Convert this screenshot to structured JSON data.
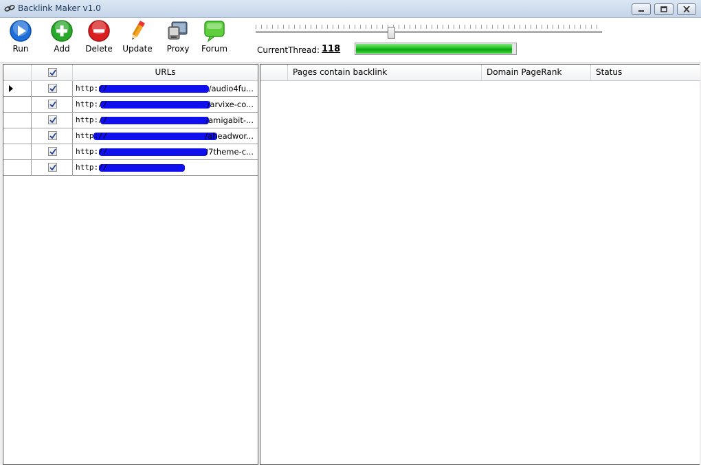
{
  "window": {
    "title": "Backlink Maker v1.0"
  },
  "toolbar": {
    "buttons": [
      {
        "label": "Run",
        "icon": "play-icon"
      },
      {
        "label": "Add",
        "icon": "plus-icon"
      },
      {
        "label": "Delete",
        "icon": "minus-icon"
      },
      {
        "label": "Update",
        "icon": "pencil-icon"
      },
      {
        "label": "Proxy",
        "icon": "proxy-icon"
      },
      {
        "label": "Forum",
        "icon": "chat-bubble-icon"
      }
    ],
    "current_thread_label": "CurrentThread:",
    "current_thread_value": "118",
    "progress_fraction": 0.98,
    "thread_slider_fraction": 0.39
  },
  "url_grid": {
    "header": "URLs",
    "header_checked": true,
    "rows": [
      {
        "prefix": "http://",
        "suffix": "/audio4fu...",
        "checked": true,
        "current": true
      },
      {
        "prefix": "http://",
        "suffix": "/arvixe-co...",
        "checked": true,
        "current": false
      },
      {
        "prefix": "http://",
        "suffix": "/amigabit-...",
        "checked": true,
        "current": false
      },
      {
        "prefix": "http://",
        "suffix": "/aheadwor...",
        "checked": true,
        "current": false
      },
      {
        "prefix": "http://",
        "suffix": "/7theme-c...",
        "checked": true,
        "current": false
      },
      {
        "prefix": "http://",
        "suffix": "",
        "checked": true,
        "current": false
      }
    ]
  },
  "results_grid": {
    "columns": [
      "Pages contain backlink",
      "Domain PageRank",
      "Status"
    ]
  },
  "colors": {
    "progress_green": "#1fc01f",
    "redaction_blue": "#1010ee",
    "run_blue": "#1e6fd9",
    "add_green": "#2aa82a",
    "delete_red": "#d92020"
  }
}
